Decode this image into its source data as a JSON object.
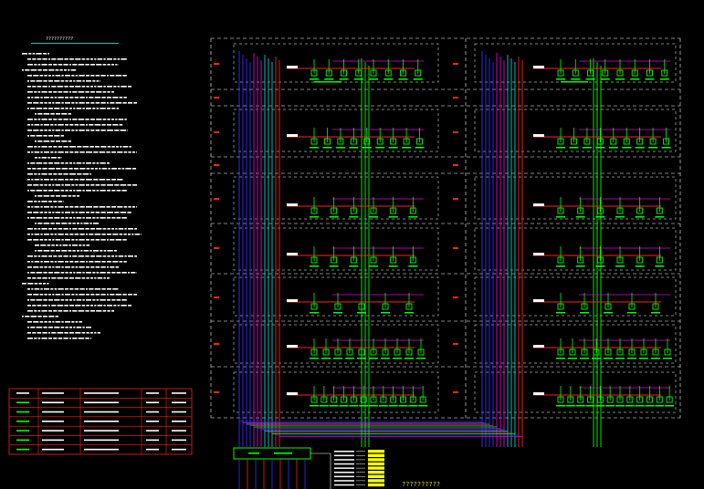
{
  "drawing": {
    "notes_title": "??????????",
    "caption": "??????????",
    "floor_tags": [
      "?",
      "?",
      "?",
      "?",
      "?",
      "?",
      "?",
      "?"
    ]
  },
  "colors": {
    "background": "#000000",
    "frame": "#ffffff",
    "device": "#00ff00",
    "riser_blue": "#3030ff",
    "riser_magenta": "#e000e0",
    "riser_cyan": "#00d0d0",
    "riser_red": "#ff2020",
    "riser_green": "#00ff00",
    "table_border": "#ff2020",
    "highlight": "#ffff00"
  },
  "legend_table": {
    "columns": 5,
    "rows": 7
  }
}
